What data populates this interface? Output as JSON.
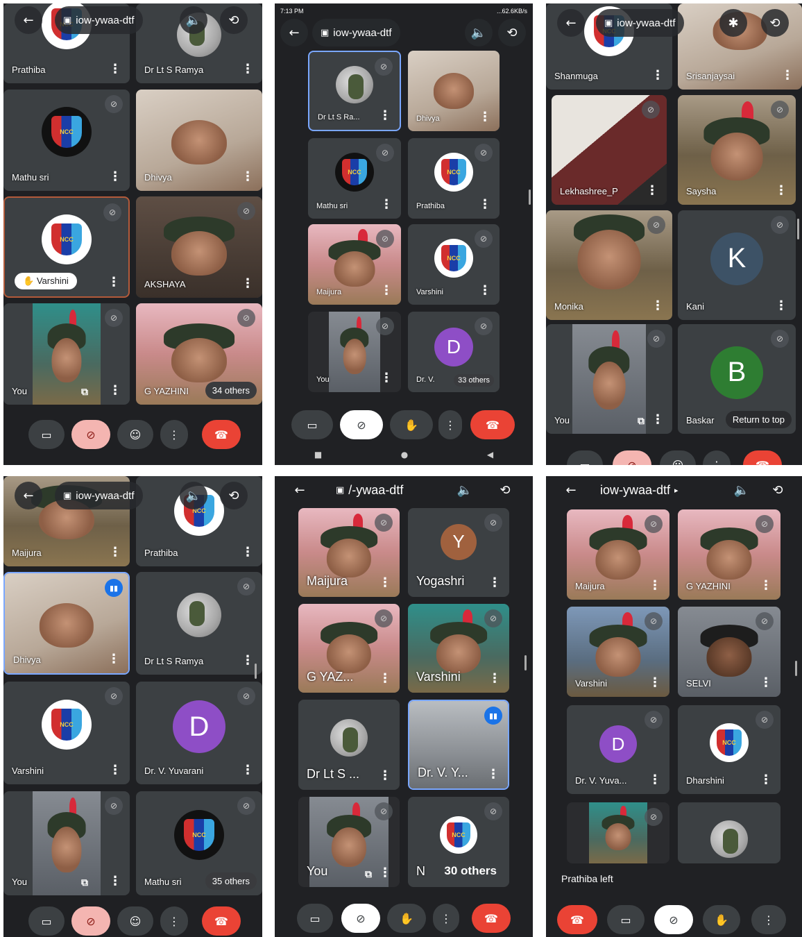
{
  "meeting_code": "iow-ywaa-dtf",
  "meeting_code_truncated": "/-ywaa-dtf",
  "p1": {
    "tiles": [
      "Prathiba",
      "Dr Lt S Ramya",
      "Mathu sri",
      "Dhivya",
      "Varshini",
      "AKSHAYA",
      "You",
      "G YAZHINI"
    ],
    "others": "34 others"
  },
  "p2": {
    "time": "7:13 PM",
    "net": "...62.6KB/s",
    "tiles": [
      "Dr Lt S Ra...",
      "Dhivya",
      "Mathu sri",
      "Prathiba",
      "Maijura",
      "Varshini",
      "You",
      "Dr. V."
    ],
    "letter": "D",
    "others": "33 others"
  },
  "p3": {
    "tiles": [
      "Shanmuga",
      "Srisanjaysai",
      "Lekhashree_P",
      "Saysha",
      "Monika",
      "Kani",
      "You",
      "Baskar"
    ],
    "letters": [
      "K",
      "B"
    ],
    "return": "Return to top"
  },
  "p4": {
    "tiles": [
      "Maijura",
      "Prathiba",
      "Dhivya",
      "Dr Lt S Ramya",
      "Varshini",
      "Dr. V. Yuvarani",
      "You",
      "Mathu sri"
    ],
    "letter": "D",
    "others": "35 others"
  },
  "p5": {
    "tiles": [
      "Maijura",
      "Yogashri",
      "G YAZ...",
      "Varshini",
      "Dr Lt S ...",
      "Dr. V. Y...",
      "You",
      "N"
    ],
    "letter": "Y",
    "others": "30 others"
  },
  "p6": {
    "tiles": [
      "Maijura",
      "G YAZHINI",
      "Varshini",
      "SELVI",
      "Dr. V. Yuva...",
      "Dharshini"
    ],
    "letter": "D",
    "toast": "Prathiba left"
  },
  "logo_text": "NCC",
  "colors": {
    "purple": "#8e4ec6",
    "brown": "#a0613e",
    "slate": "#3d5266",
    "green": "#2e7d32",
    "red": "#ea4335"
  },
  "icons": {
    "back": "←",
    "calendar": "📅",
    "speaker": "🔈",
    "switch": "⟲",
    "bluetooth": "✱",
    "camera": "▭",
    "mic_off": "🎙",
    "emoji": "☺",
    "more": "⋮",
    "hangup": "☎",
    "hand": "✋",
    "mute": "⊘",
    "speak": "▮▮",
    "present": "⧉"
  }
}
